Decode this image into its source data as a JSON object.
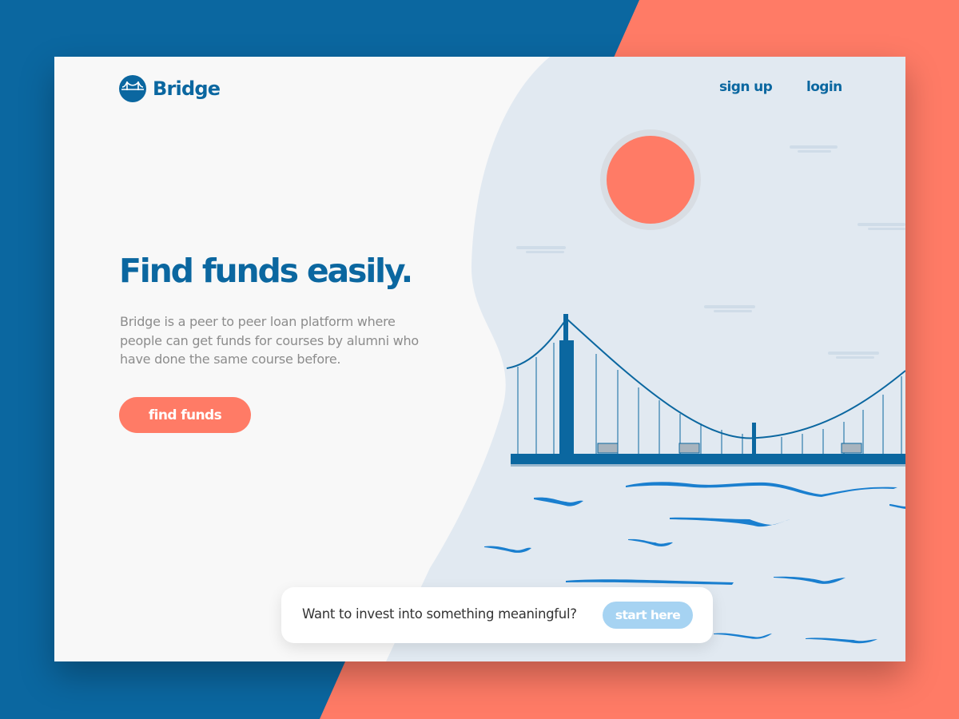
{
  "brand": {
    "name": "Bridge",
    "logo_icon": "bridge-logo-icon"
  },
  "nav": {
    "signup_label": "sign up",
    "login_label": "login"
  },
  "hero": {
    "headline": "Find funds easily.",
    "description": "Bridge is a peer to peer loan platform where people can get funds for courses by alumni who have done the same course before.",
    "cta_label": "find funds"
  },
  "invest_banner": {
    "text": "Want to invest into something meaningful?",
    "button_label": "start here"
  },
  "illustration": {
    "subject": "suspension-bridge-over-water-with-sun"
  },
  "colors": {
    "brand_blue": "#0b67a0",
    "accent_coral": "#ff7b66",
    "sky": "#e1e9f1",
    "light_button": "#a6d3f2",
    "water_blue": "#1a7fcf"
  }
}
